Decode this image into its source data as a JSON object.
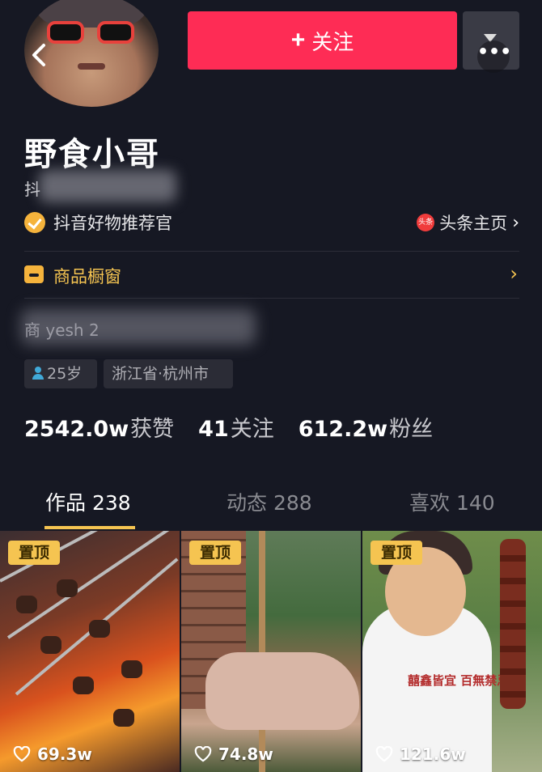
{
  "header": {
    "follow_label": "关注",
    "follow_plus": "+",
    "more_dots": "•••"
  },
  "profile": {
    "name": "野食小哥",
    "douyin_id_prefix": "抖",
    "badge_text": "抖音好物推荐官",
    "toutiao_icon_text": "头条",
    "toutiao_label": "头条主页",
    "chevron": "›",
    "shop_label": "商品橱窗",
    "blurred_line": "商 yesh 2",
    "age_tag": "25岁",
    "location_tag": "浙江省·杭州市"
  },
  "stats": {
    "likes_num": "2542.0w",
    "likes_label": "获赞",
    "following_num": "41",
    "following_label": "关注",
    "fans_num": "612.2w",
    "fans_label": "粉丝"
  },
  "tabs": [
    {
      "label": "作品 238"
    },
    {
      "label": "动态 288"
    },
    {
      "label": "喜欢 140"
    }
  ],
  "videos": [
    {
      "pin": "置顶",
      "likes": "69.3w"
    },
    {
      "pin": "置顶",
      "likes": "74.8w"
    },
    {
      "pin": "置顶",
      "likes": "121.6w",
      "shirt_text": "囍鑫皆宜 百無禁忌"
    }
  ],
  "colors": {
    "background": "#161823",
    "follow": "#fe2c55",
    "accent": "#f5c451"
  }
}
